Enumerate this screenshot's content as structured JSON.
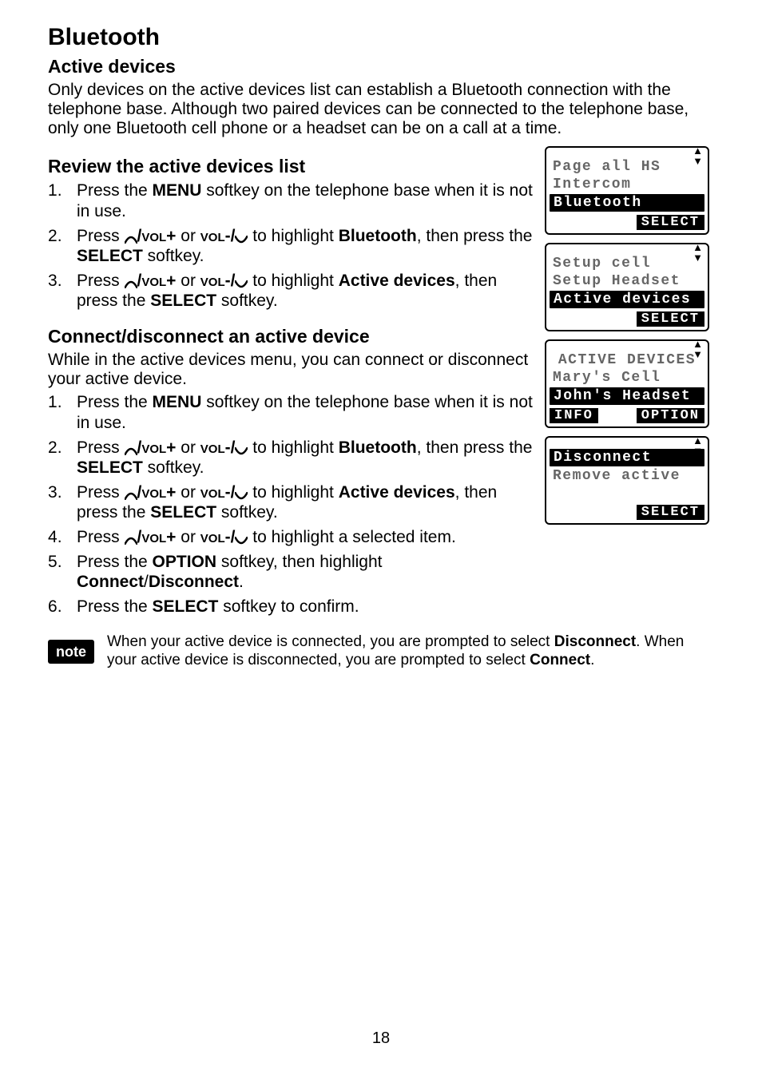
{
  "page_number": "18",
  "title": "Bluetooth",
  "h2_1": "Active devices",
  "intro": "Only devices on the active devices list can establish a Bluetooth connection with the telephone base. Although two paired devices can be connected to the telephone base, only one Bluetooth cell phone or a headset can be on a call at a time.",
  "h3_review": "Review the active devices list",
  "review_steps": {
    "s1a": "Press the ",
    "s1b": "MENU",
    "s1c": " softkey on the telephone base when it is not in use.",
    "s2a": "Press ",
    "s2_vol1": "/vol+",
    "s2_or": " or ",
    "s2_vol2": "vol-/",
    "s2b": " to highlight ",
    "s2_bt": "Bluetooth",
    "s2c": ", then press the ",
    "s2_sel": "SELECT",
    "s2d": " softkey.",
    "s3a": "Press ",
    "s3b": " to highlight ",
    "s3_ad": "Active devices",
    "s3c": ", then press the ",
    "s3d": " softkey."
  },
  "h3_connect": "Connect/disconnect an active device",
  "connect_intro": "While in the active devices menu, you can connect or disconnect your active device.",
  "connect_steps": {
    "s4a": "Press ",
    "s4b": " to highlight a selected item.",
    "s5a": "Press the ",
    "s5_opt": "OPTION",
    "s5b": " softkey, then highlight ",
    "s5_conn": "Connect",
    "s5_slash": "/",
    "s5_disc": "Disconnect",
    "s5c": ".",
    "s6a": "Press the ",
    "s6b": " softkey to confirm."
  },
  "note": {
    "badge": "note",
    "t1": "When your active device is connected, you are prompted to select ",
    "t2": "Disconnect",
    "t3": ". When your active device is disconnected, you are prompted to select ",
    "t4": "Connect",
    "t5": "."
  },
  "lcd1": {
    "l1": "Page all HS",
    "l2": "Intercom",
    "l3": "Bluetooth",
    "sk": "SELECT"
  },
  "lcd2": {
    "l1": "Setup cell",
    "l2": "Setup Headset",
    "l3": "Active devices",
    "sk": "SELECT"
  },
  "lcd3": {
    "title": "ACTIVE DEVICES",
    "l1": "Mary's Cell",
    "l2": "John's Headset",
    "sk1": "INFO",
    "sk2": "OPTION"
  },
  "lcd4": {
    "l1": "Disconnect",
    "l2": "Remove active",
    "sk": "SELECT"
  }
}
